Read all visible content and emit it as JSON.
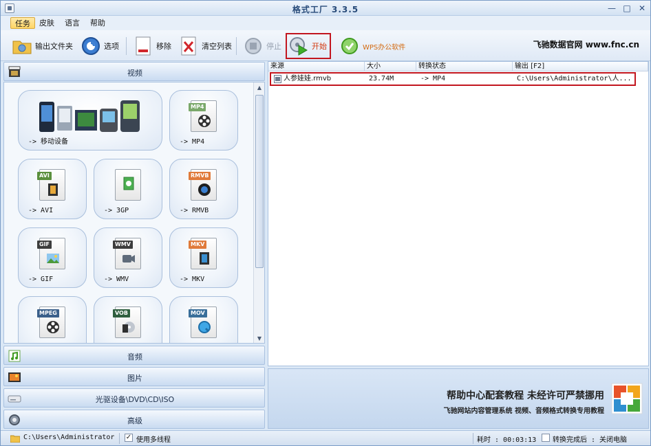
{
  "window": {
    "title": "格式工厂 3.3.5"
  },
  "menu": [
    {
      "label": "任务",
      "active": true
    },
    {
      "label": "皮肤"
    },
    {
      "label": "语言"
    },
    {
      "label": "帮助"
    }
  ],
  "toolbar": {
    "output_folder": "输出文件夹",
    "options": "选项",
    "remove": "移除",
    "clear_list": "清空列表",
    "stop": "停止",
    "start": "开始",
    "wps": "WPS办公软件",
    "brand": "飞驰数据官网 www.fnc.cn"
  },
  "left": {
    "video_header": "视频",
    "tiles": [
      {
        "label": "-> 移动设备",
        "tag": "",
        "icon": "mobile-devices-icon"
      },
      {
        "label": "-> MP4",
        "tag": "MP4",
        "tag_color": "#7aa86a",
        "icon": "mp4-icon"
      },
      {
        "label": "-> AVI",
        "tag": "AVI",
        "tag_color": "#5a8f3c",
        "icon": "avi-icon"
      },
      {
        "label": "-> 3GP",
        "tag": "",
        "icon": "3gp-icon"
      },
      {
        "label": "-> RMVB",
        "tag": "RMVB",
        "tag_color": "#e07a3a",
        "icon": "rmvb-icon"
      },
      {
        "label": "-> GIF",
        "tag": "GIF",
        "tag_color": "#3d3d3d",
        "icon": "gif-icon"
      },
      {
        "label": "-> WMV",
        "tag": "WMV",
        "tag_color": "#3d3d3d",
        "icon": "wmv-icon"
      },
      {
        "label": "-> MKV",
        "tag": "MKV",
        "tag_color": "#e07a3a",
        "icon": "mkv-icon"
      },
      {
        "label": "",
        "tag": "MPEG",
        "tag_color": "#3a5f8a",
        "icon": "mpeg-icon"
      },
      {
        "label": "",
        "tag": "VOB",
        "tag_color": "#2f5f3f",
        "icon": "vob-icon"
      },
      {
        "label": "",
        "tag": "MOV",
        "tag_color": "#3a6f9a",
        "icon": "mov-icon"
      }
    ],
    "audio_header": "音频",
    "picture_header": "图片",
    "disc_header": "光驱设备\\DVD\\CD\\ISO",
    "advanced_header": "高级"
  },
  "list": {
    "columns": [
      "来源",
      "大小",
      "转换状态",
      "输出 [F2]"
    ],
    "rows": [
      {
        "source": "人参娃娃.rmvb",
        "size": "23.74M",
        "status": "-> MP4",
        "output": "C:\\Users\\Administrator\\人..."
      }
    ]
  },
  "banner": {
    "title": "帮助中心配套教程  未经许可严禁挪用",
    "subtitle": "飞驰网站内容管理系统  视频、音频格式转换专用教程"
  },
  "status": {
    "path": "C:\\Users\\Administrator",
    "multithread_label": "使用多线程",
    "elapsed": "耗时 : 00:03:13",
    "after_convert": "转换完成后 : 关闭电脑"
  }
}
